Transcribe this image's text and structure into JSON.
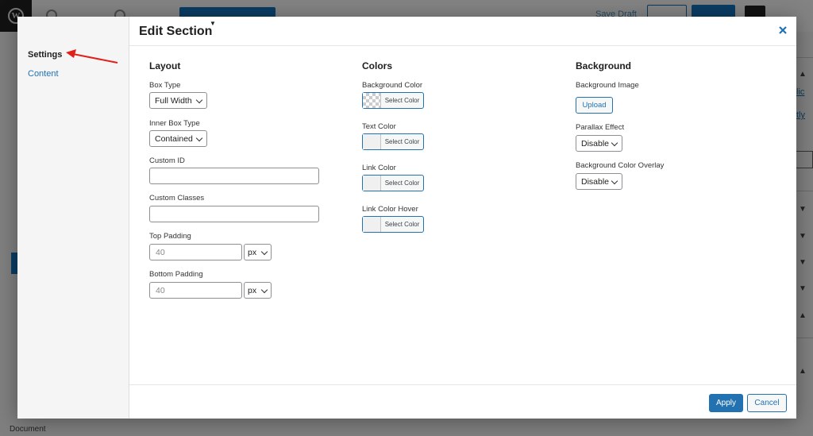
{
  "modal": {
    "title": "Edit Section",
    "sidebar": {
      "items": [
        {
          "label": "Settings",
          "active": true
        },
        {
          "label": "Content",
          "active": false
        }
      ]
    },
    "layout": {
      "heading": "Layout",
      "box_type": {
        "label": "Box Type",
        "value": "Full Width"
      },
      "inner_box_type": {
        "label": "Inner Box Type",
        "value": "Contained"
      },
      "custom_id": {
        "label": "Custom ID",
        "value": ""
      },
      "custom_classes": {
        "label": "Custom Classes",
        "value": ""
      },
      "top_padding": {
        "label": "Top Padding",
        "value": "40",
        "unit": "px"
      },
      "bottom_padding": {
        "label": "Bottom Padding",
        "value": "40",
        "unit": "px"
      }
    },
    "colors": {
      "heading": "Colors",
      "fields": [
        {
          "label": "Background Color",
          "button": "Select Color",
          "swatch": "transparent"
        },
        {
          "label": "Text Color",
          "button": "Select Color",
          "swatch": "#f0f0f1"
        },
        {
          "label": "Link Color",
          "button": "Select Color",
          "swatch": "#f0f0f1"
        },
        {
          "label": "Link Color Hover",
          "button": "Select Color",
          "swatch": "#f0f0f1"
        }
      ]
    },
    "background": {
      "heading": "Background",
      "background_image": {
        "label": "Background Image",
        "button": "Upload"
      },
      "parallax_effect": {
        "label": "Parallax Effect",
        "value": "Disable"
      },
      "color_overlay": {
        "label": "Background Color Overlay",
        "value": "Disable"
      }
    },
    "footer": {
      "apply": "Apply",
      "cancel": "Cancel"
    }
  },
  "background_page": {
    "save_draft": "Save Draft",
    "status_bar_label": "Document"
  },
  "colors": {
    "accent": "#2271b1",
    "annotation_arrow": "#e0201b",
    "overlay": "#7f7f7f"
  },
  "icons": {
    "close": "close-icon",
    "annotation": "red-arrow-icon",
    "wordpress": "wordpress-logo-icon"
  }
}
